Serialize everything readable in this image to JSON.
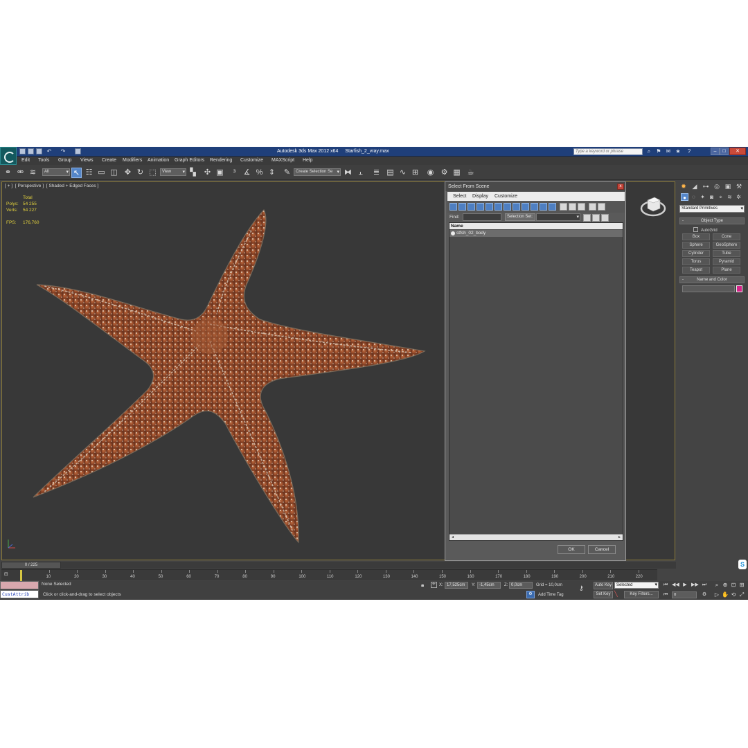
{
  "window": {
    "app_title": "Autodesk 3ds Max  2012 x64",
    "file_name": "Starfish_2_vray.max",
    "search_placeholder": "Type a keyword or phrase"
  },
  "menu": [
    "Edit",
    "Tools",
    "Group",
    "Views",
    "Create",
    "Modifiers",
    "Animation",
    "Graph Editors",
    "Rendering",
    "Customize",
    "MAXScript",
    "Help"
  ],
  "toolbar": {
    "selection_filter": "All",
    "reference_coord": "View",
    "named_selection": "Create Selection Se"
  },
  "viewport": {
    "label_parts": [
      "[ + ]",
      "[ Perspective ]",
      "[ Shaded + Edged Faces ]"
    ],
    "stats": {
      "header": "Total",
      "polys_label": "Polys:",
      "polys": "54 255",
      "verts_label": "Verts:",
      "verts": "54 227",
      "fps_label": "FPS:",
      "fps": "176,760"
    }
  },
  "dialog": {
    "title": "Select From Scene",
    "close": "x",
    "menus": [
      "Select",
      "Display",
      "Customize"
    ],
    "find_label": "Find:",
    "selection_set_label": "Selection Set:",
    "column_name": "Name",
    "objects": [
      "stfsh_02_body"
    ],
    "ok": "OK",
    "cancel": "Cancel"
  },
  "command_panel": {
    "category": "Standard Primitives",
    "object_type_title": "Object Type",
    "autogrid": "AutoGrid",
    "primitives": [
      "Box",
      "Cone",
      "Sphere",
      "GeoSphere",
      "Cylinder",
      "Tube",
      "Torus",
      "Pyramid",
      "Teapot",
      "Plane"
    ],
    "name_color_title": "Name and Color",
    "object_color": "#d6248a"
  },
  "timeline": {
    "slider_text": "0 / 225",
    "ticks": [
      10,
      20,
      30,
      40,
      50,
      60,
      70,
      80,
      90,
      100,
      110,
      120,
      130,
      140,
      150,
      160,
      170,
      180,
      190,
      200,
      210,
      220
    ]
  },
  "status": {
    "maxscript_listener": "CustAttrib",
    "selection": "None Selected",
    "prompt": "Click or click-and-drag to select objects",
    "x_label": "X:",
    "x": "17,525cm",
    "y_label": "Y:",
    "y": "-1,45cm",
    "z_label": "Z:",
    "z": "0,0cm",
    "grid": "Grid = 10,0cm",
    "add_time_tag": "Add Time Tag",
    "auto_key": "Auto Key",
    "key_mode": "Selected",
    "set_key": "Set Key",
    "key_filters": "Key Filters...",
    "current_frame": "0"
  }
}
